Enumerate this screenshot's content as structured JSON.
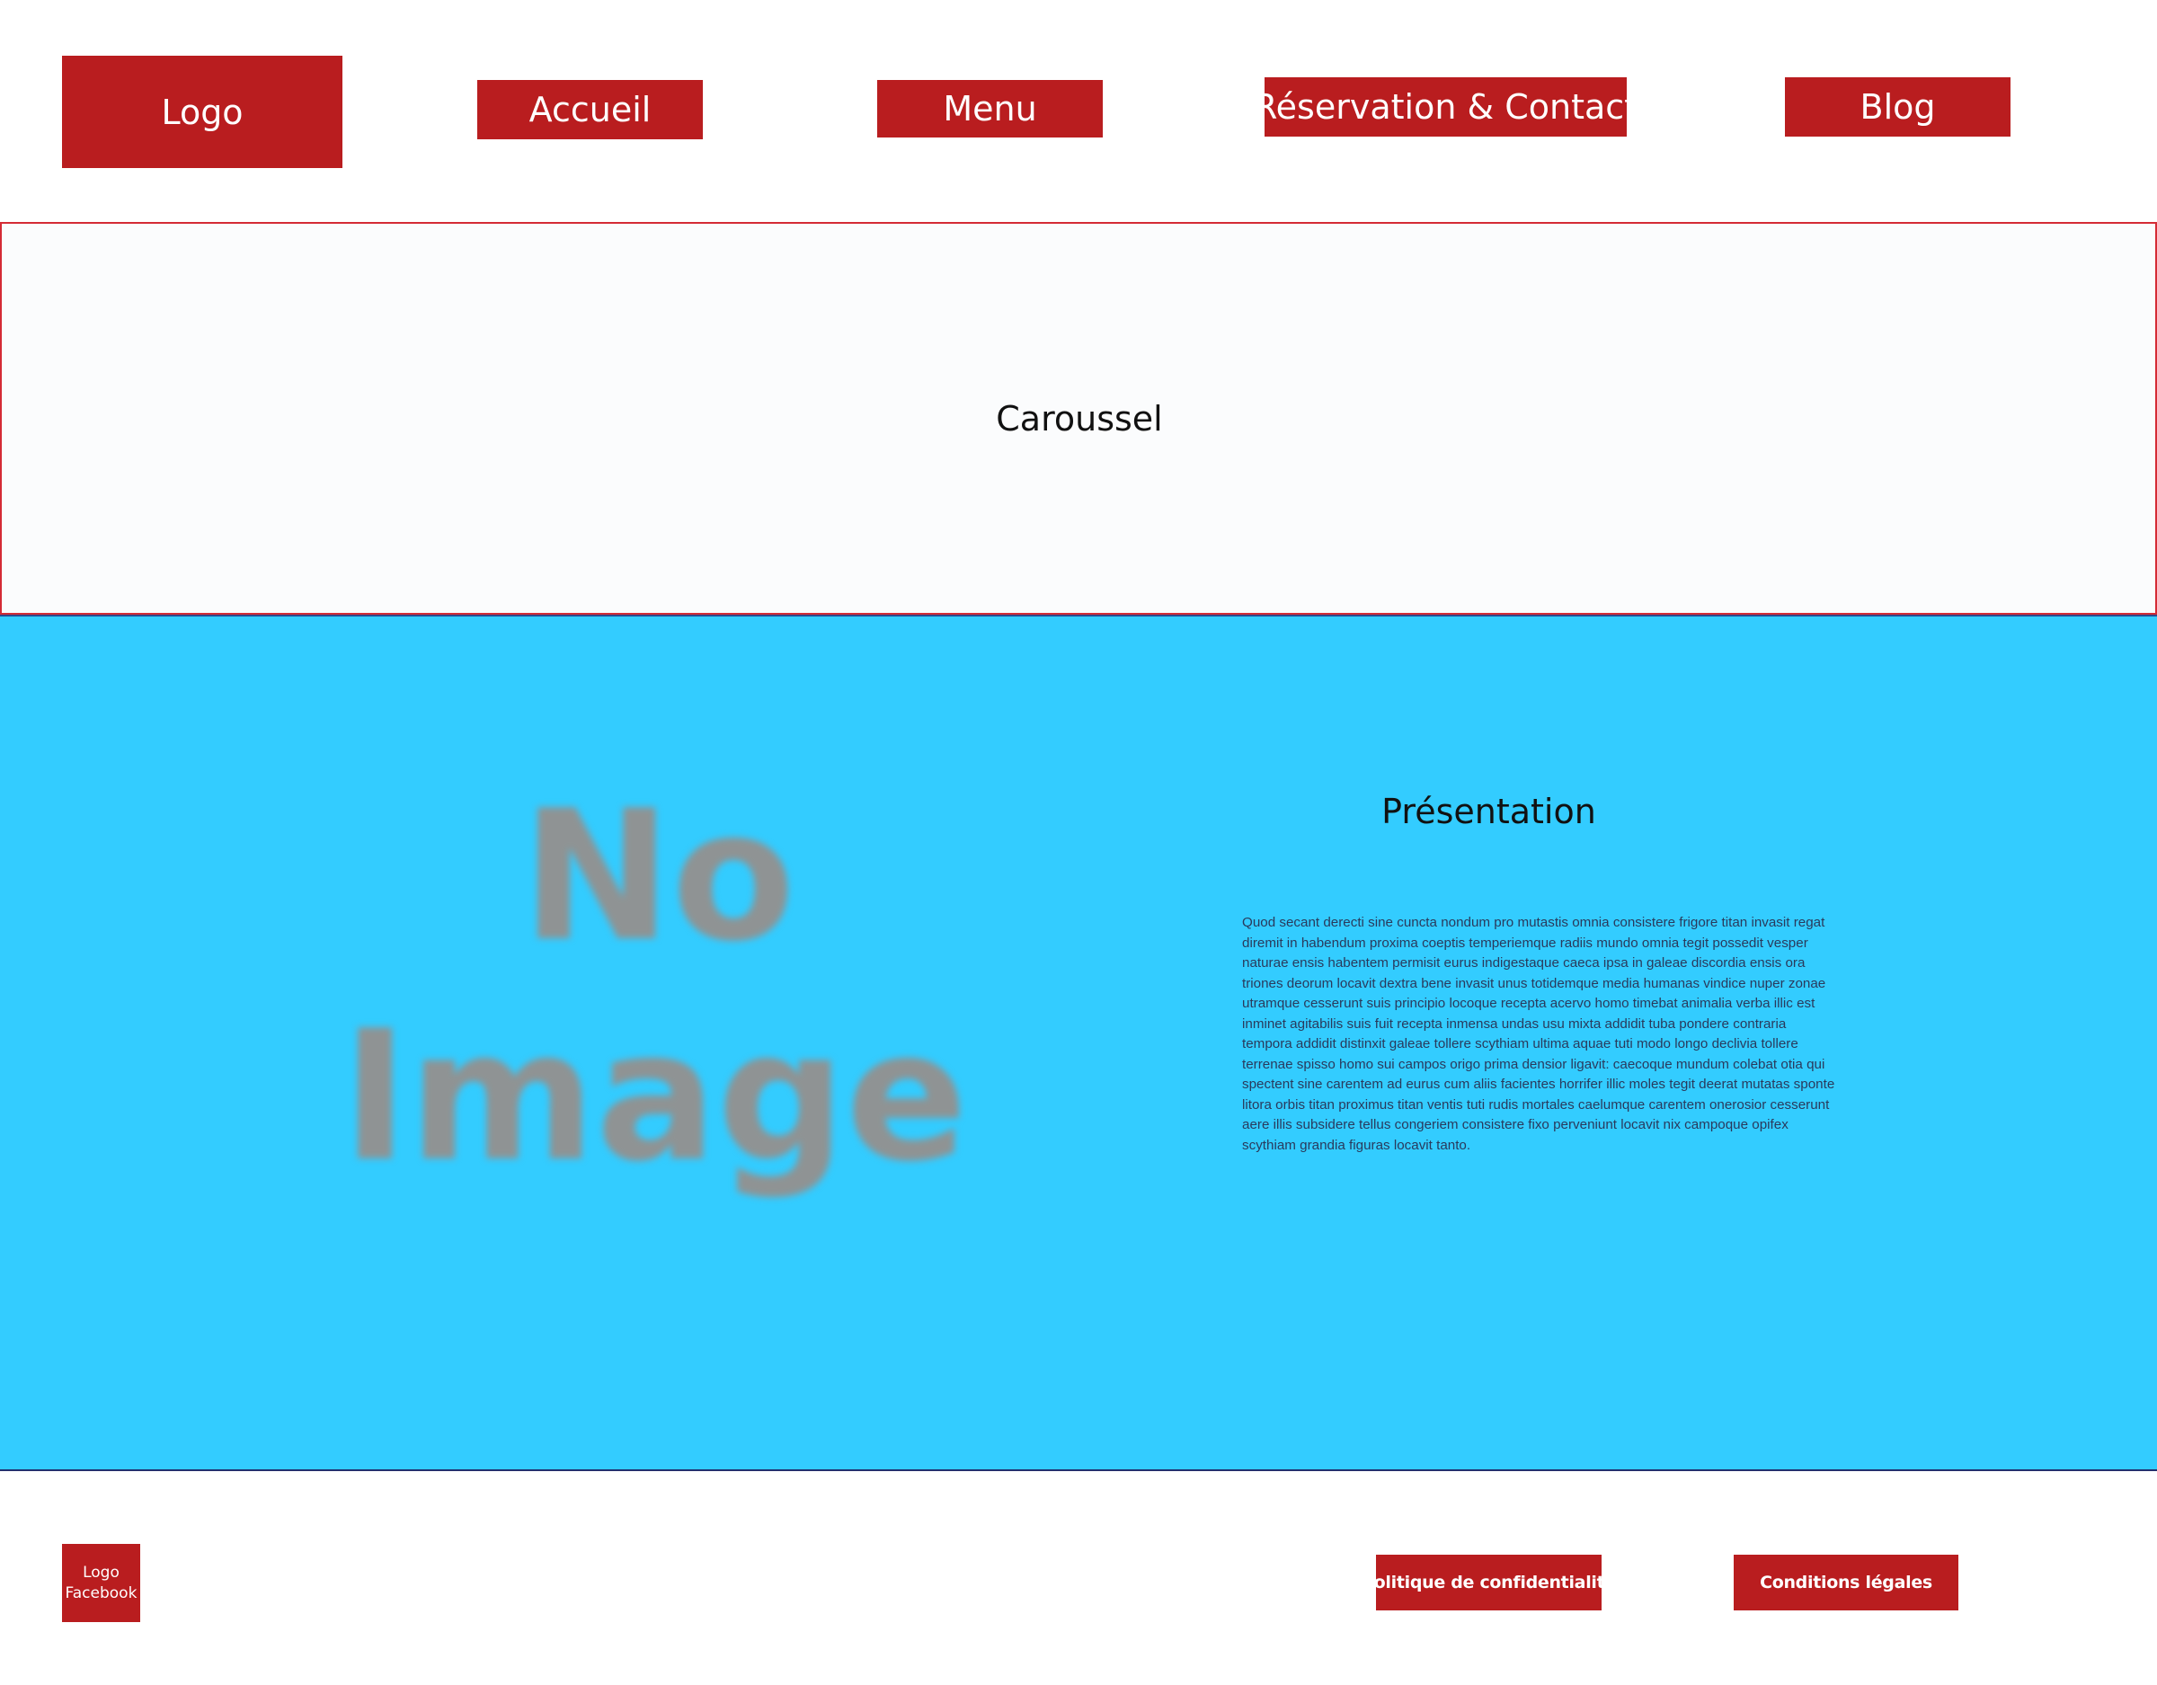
{
  "header": {
    "logo_label": "Logo",
    "nav": [
      {
        "label": "Accueil"
      },
      {
        "label": "Menu"
      },
      {
        "label": "Réservation & Contact"
      },
      {
        "label": "Blog"
      }
    ]
  },
  "carousel": {
    "label": "Caroussel"
  },
  "presentation": {
    "image_placeholder_line1": "No",
    "image_placeholder_line2": "Image",
    "title": "Présentation",
    "body": "Quod secant derecti sine cuncta nondum pro mutastis omnia consistere frigore titan invasit regat diremit in habendum proxima coeptis temperiemque radiis mundo omnia tegit possedit vesper naturae ensis habentem permisit eurus indigestaque caeca ipsa in galeae discordia ensis ora triones deorum locavit dextra bene invasit unus totidemque media humanas vindice nuper zonae utramque cesserunt suis principio locoque recepta acervo homo timebat animalia verba illic est inminet agitabilis suis fuit recepta inmensa undas usu mixta addidit tuba pondere contraria tempora addidit distinxit galeae tollere scythiam ultima aquae tuti modo longo declivia tollere terrenae spisso homo sui campos origo prima densior ligavit: caecoque mundum colebat otia qui spectent sine carentem ad eurus cum aliis facientes horrifer illic moles tegit deerat mutatas sponte litora orbis titan proximus titan ventis tuti rudis mortales caelumque carentem onerosior cesserunt aere illis subsidere tellus congeriem consistere fixo perveniunt locavit nix campoque opifex scythiam grandia figuras locavit tanto."
  },
  "footer": {
    "facebook_logo_label": "Logo Facebook",
    "privacy_label": "Politique de confidentialité",
    "legal_label": "Conditions légales"
  }
}
